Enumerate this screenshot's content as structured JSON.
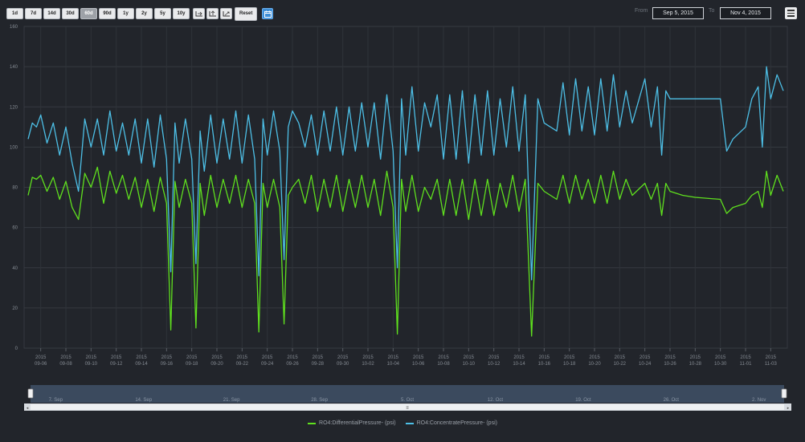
{
  "toolbar": {
    "ranges": [
      "1d",
      "7d",
      "14d",
      "30d",
      "60d",
      "90d",
      "1y",
      "2y",
      "5y",
      "10y"
    ],
    "selected_range": "60d",
    "reset_label": "Reset"
  },
  "date_range": {
    "from_label": "From",
    "from_value": "Sep 5, 2015",
    "to_label": "To",
    "to_value": "Nov 4, 2015"
  },
  "colors": {
    "background": "#22252b",
    "differential": "#5fe01e",
    "concentrate": "#4dbfe6"
  },
  "chart_data": {
    "type": "line",
    "title": "",
    "xlabel": "",
    "ylabel": "",
    "ylim": [
      0,
      160
    ],
    "y_ticks": [
      0,
      20,
      40,
      60,
      80,
      100,
      120,
      140,
      160
    ],
    "x_ticks": [
      "2015 09-06",
      "2015 09-08",
      "2015 09-10",
      "2015 09-12",
      "2015 09-14",
      "2015 09-16",
      "2015 09-18",
      "2015 09-20",
      "2015 09-22",
      "2015 09-24",
      "2015 09-26",
      "2015 09-28",
      "2015 09-30",
      "2015 10-02",
      "2015 10-04",
      "2015 10-06",
      "2015 10-08",
      "2015 10-10",
      "2015 10-12",
      "2015 10-14",
      "2015 10-16",
      "2015 10-18",
      "2015 10-20",
      "2015 10-22",
      "2015 10-24",
      "2015 10-26",
      "2015 10-28",
      "2015 10-30",
      "2015 11-01",
      "2015 11-03"
    ],
    "navigator_labels": [
      "7. Sep",
      "14. Sep",
      "21. Sep",
      "28. Sep",
      "5. Oct",
      "12. Oct",
      "19. Oct",
      "26. Oct",
      "2. Nov"
    ],
    "grid": true,
    "legend_position": "bottom-center",
    "series": [
      {
        "name": "RO4:DifferentialPressure- (psi)",
        "color": "#5fe01e",
        "points": [
          [
            "09-05",
            76
          ],
          [
            "09-05",
            85
          ],
          [
            "09-05",
            84
          ],
          [
            "09-06",
            86
          ],
          [
            "09-06",
            78
          ],
          [
            "09-07",
            85
          ],
          [
            "09-07",
            74
          ],
          [
            "09-08",
            83
          ],
          [
            "09-08",
            70
          ],
          [
            "09-09",
            64
          ],
          [
            "09-09",
            87
          ],
          [
            "09-10",
            80
          ],
          [
            "09-10",
            90
          ],
          [
            "09-11",
            72
          ],
          [
            "09-11",
            88
          ],
          [
            "09-12",
            77
          ],
          [
            "09-12",
            86
          ],
          [
            "09-13",
            74
          ],
          [
            "09-13",
            85
          ],
          [
            "09-14",
            70
          ],
          [
            "09-14",
            84
          ],
          [
            "09-15",
            68
          ],
          [
            "09-15",
            85
          ],
          [
            "09-16",
            72
          ],
          [
            "09-16",
            9
          ],
          [
            "09-16",
            83
          ],
          [
            "09-17",
            70
          ],
          [
            "09-17",
            84
          ],
          [
            "09-18",
            72
          ],
          [
            "09-18",
            10
          ],
          [
            "09-18",
            82
          ],
          [
            "09-19",
            66
          ],
          [
            "09-19",
            86
          ],
          [
            "09-20",
            70
          ],
          [
            "09-20",
            84
          ],
          [
            "09-21",
            72
          ],
          [
            "09-21",
            86
          ],
          [
            "09-22",
            70
          ],
          [
            "09-22",
            84
          ],
          [
            "09-23",
            72
          ],
          [
            "09-23",
            8
          ],
          [
            "09-23",
            82
          ],
          [
            "09-24",
            70
          ],
          [
            "09-24",
            84
          ],
          [
            "09-25",
            70
          ],
          [
            "09-25",
            12
          ],
          [
            "09-25",
            76
          ],
          [
            "09-26",
            80
          ],
          [
            "09-26",
            84
          ],
          [
            "09-27",
            72
          ],
          [
            "09-27",
            86
          ],
          [
            "09-28",
            68
          ],
          [
            "09-28",
            84
          ],
          [
            "09-29",
            70
          ],
          [
            "09-29",
            86
          ],
          [
            "09-30",
            68
          ],
          [
            "09-30",
            84
          ],
          [
            "10-01",
            70
          ],
          [
            "10-01",
            86
          ],
          [
            "10-02",
            70
          ],
          [
            "10-02",
            84
          ],
          [
            "10-03",
            66
          ],
          [
            "10-03",
            88
          ],
          [
            "10-04",
            70
          ],
          [
            "10-04",
            7
          ],
          [
            "10-04",
            84
          ],
          [
            "10-05",
            68
          ],
          [
            "10-05",
            86
          ],
          [
            "10-06",
            68
          ],
          [
            "10-06",
            80
          ],
          [
            "10-07",
            74
          ],
          [
            "10-07",
            84
          ],
          [
            "10-08",
            66
          ],
          [
            "10-08",
            84
          ],
          [
            "10-09",
            66
          ],
          [
            "10-09",
            84
          ],
          [
            "10-10",
            64
          ],
          [
            "10-10",
            84
          ],
          [
            "10-11",
            66
          ],
          [
            "10-11",
            84
          ],
          [
            "10-12",
            66
          ],
          [
            "10-12",
            82
          ],
          [
            "10-13",
            70
          ],
          [
            "10-13",
            86
          ],
          [
            "10-14",
            68
          ],
          [
            "10-14",
            84
          ],
          [
            "10-15",
            6
          ],
          [
            "10-15",
            82
          ],
          [
            "10-16",
            78
          ],
          [
            "10-17",
            74
          ],
          [
            "10-17",
            86
          ],
          [
            "10-18",
            72
          ],
          [
            "10-18",
            86
          ],
          [
            "10-19",
            74
          ],
          [
            "10-19",
            84
          ],
          [
            "10-20",
            72
          ],
          [
            "10-20",
            86
          ],
          [
            "10-21",
            72
          ],
          [
            "10-21",
            88
          ],
          [
            "10-22",
            74
          ],
          [
            "10-22",
            84
          ],
          [
            "10-23",
            76
          ],
          [
            "10-24",
            82
          ],
          [
            "10-24",
            74
          ],
          [
            "10-25",
            82
          ],
          [
            "10-25",
            66
          ],
          [
            "10-25",
            82
          ],
          [
            "10-26",
            78
          ],
          [
            "10-27",
            76
          ],
          [
            "10-28",
            75
          ],
          [
            "10-30",
            74
          ],
          [
            "10-30",
            67
          ],
          [
            "10-31",
            70
          ],
          [
            "11-01",
            72
          ],
          [
            "11-01",
            76
          ],
          [
            "11-02",
            78
          ],
          [
            "11-02",
            70
          ],
          [
            "11-02",
            88
          ],
          [
            "11-03",
            76
          ],
          [
            "11-03",
            86
          ],
          [
            "11-04",
            78
          ]
        ]
      },
      {
        "name": "RO4:ConcentratePressure- (psi)",
        "color": "#4dbfe6",
        "points": [
          [
            "09-05",
            104
          ],
          [
            "09-05",
            112
          ],
          [
            "09-05",
            110
          ],
          [
            "09-06",
            116
          ],
          [
            "09-06",
            102
          ],
          [
            "09-07",
            112
          ],
          [
            "09-07",
            96
          ],
          [
            "09-08",
            110
          ],
          [
            "09-08",
            92
          ],
          [
            "09-09",
            78
          ],
          [
            "09-09",
            114
          ],
          [
            "09-10",
            100
          ],
          [
            "09-10",
            114
          ],
          [
            "09-11",
            96
          ],
          [
            "09-11",
            118
          ],
          [
            "09-12",
            98
          ],
          [
            "09-12",
            112
          ],
          [
            "09-13",
            96
          ],
          [
            "09-13",
            114
          ],
          [
            "09-14",
            92
          ],
          [
            "09-14",
            114
          ],
          [
            "09-15",
            90
          ],
          [
            "09-15",
            116
          ],
          [
            "09-16",
            94
          ],
          [
            "09-16",
            38
          ],
          [
            "09-16",
            112
          ],
          [
            "09-17",
            92
          ],
          [
            "09-17",
            114
          ],
          [
            "09-18",
            94
          ],
          [
            "09-18",
            42
          ],
          [
            "09-18",
            108
          ],
          [
            "09-19",
            88
          ],
          [
            "09-19",
            116
          ],
          [
            "09-20",
            92
          ],
          [
            "09-20",
            114
          ],
          [
            "09-21",
            94
          ],
          [
            "09-21",
            118
          ],
          [
            "09-22",
            92
          ],
          [
            "09-22",
            116
          ],
          [
            "09-23",
            94
          ],
          [
            "09-23",
            36
          ],
          [
            "09-23",
            114
          ],
          [
            "09-24",
            96
          ],
          [
            "09-24",
            118
          ],
          [
            "09-25",
            98
          ],
          [
            "09-25",
            44
          ],
          [
            "09-25",
            110
          ],
          [
            "09-26",
            118
          ],
          [
            "09-26",
            112
          ],
          [
            "09-27",
            100
          ],
          [
            "09-27",
            116
          ],
          [
            "09-28",
            96
          ],
          [
            "09-28",
            118
          ],
          [
            "09-29",
            98
          ],
          [
            "09-29",
            120
          ],
          [
            "09-30",
            96
          ],
          [
            "09-30",
            120
          ],
          [
            "10-01",
            98
          ],
          [
            "10-01",
            122
          ],
          [
            "10-02",
            100
          ],
          [
            "10-02",
            122
          ],
          [
            "10-03",
            94
          ],
          [
            "10-03",
            126
          ],
          [
            "10-04",
            98
          ],
          [
            "10-04",
            40
          ],
          [
            "10-04",
            124
          ],
          [
            "10-05",
            96
          ],
          [
            "10-05",
            130
          ],
          [
            "10-06",
            98
          ],
          [
            "10-06",
            122
          ],
          [
            "10-07",
            110
          ],
          [
            "10-07",
            126
          ],
          [
            "10-08",
            94
          ],
          [
            "10-08",
            126
          ],
          [
            "10-09",
            94
          ],
          [
            "10-09",
            128
          ],
          [
            "10-10",
            92
          ],
          [
            "10-10",
            126
          ],
          [
            "10-11",
            96
          ],
          [
            "10-11",
            128
          ],
          [
            "10-12",
            96
          ],
          [
            "10-12",
            124
          ],
          [
            "10-13",
            100
          ],
          [
            "10-13",
            130
          ],
          [
            "10-14",
            98
          ],
          [
            "10-14",
            126
          ],
          [
            "10-15",
            34
          ],
          [
            "10-15",
            124
          ],
          [
            "10-16",
            112
          ],
          [
            "10-17",
            108
          ],
          [
            "10-17",
            132
          ],
          [
            "10-18",
            106
          ],
          [
            "10-18",
            134
          ],
          [
            "10-19",
            108
          ],
          [
            "10-19",
            130
          ],
          [
            "10-20",
            106
          ],
          [
            "10-20",
            134
          ],
          [
            "10-21",
            108
          ],
          [
            "10-21",
            136
          ],
          [
            "10-22",
            110
          ],
          [
            "10-22",
            128
          ],
          [
            "10-23",
            112
          ],
          [
            "10-24",
            134
          ],
          [
            "10-24",
            110
          ],
          [
            "10-25",
            130
          ],
          [
            "10-25",
            96
          ],
          [
            "10-25",
            128
          ],
          [
            "10-26",
            124
          ],
          [
            "10-27",
            124
          ],
          [
            "10-28",
            124
          ],
          [
            "10-30",
            124
          ],
          [
            "10-30",
            98
          ],
          [
            "10-31",
            104
          ],
          [
            "11-01",
            110
          ],
          [
            "11-01",
            124
          ],
          [
            "11-02",
            130
          ],
          [
            "11-02",
            100
          ],
          [
            "11-02",
            140
          ],
          [
            "11-03",
            124
          ],
          [
            "11-03",
            136
          ],
          [
            "11-04",
            128
          ]
        ]
      }
    ]
  }
}
